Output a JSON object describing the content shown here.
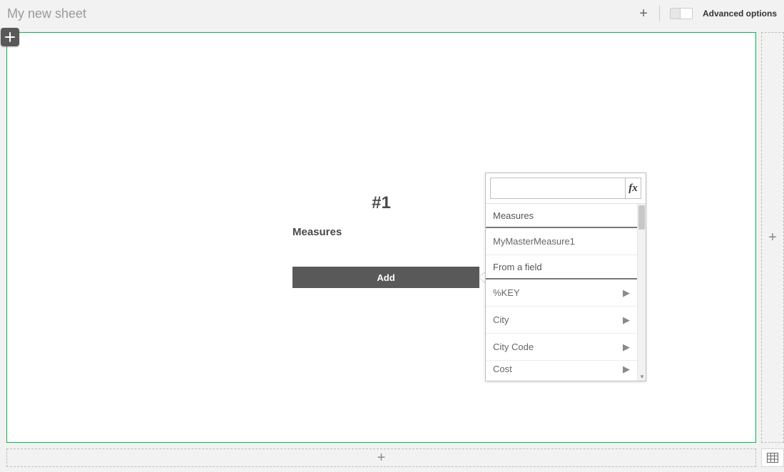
{
  "header": {
    "title": "My new sheet",
    "advanced_toggle_label": "Advanced options"
  },
  "canvas": {
    "placeholder_hash": "#1",
    "section_title": "Measures",
    "add_button_label": "Add"
  },
  "popover": {
    "search_placeholder": "",
    "fx_label": "fx",
    "groups": [
      {
        "title": "Measures",
        "items": [
          {
            "label": "MyMasterMeasure1",
            "has_sub": false
          }
        ]
      },
      {
        "title": "From a field",
        "items": [
          {
            "label": "%KEY",
            "has_sub": true
          },
          {
            "label": "City",
            "has_sub": true
          },
          {
            "label": "City Code",
            "has_sub": true
          },
          {
            "label": "Cost",
            "has_sub": true
          }
        ]
      }
    ]
  },
  "icons": {
    "plus": "+",
    "chevron_right": "▶",
    "scroll_down": "▾"
  }
}
